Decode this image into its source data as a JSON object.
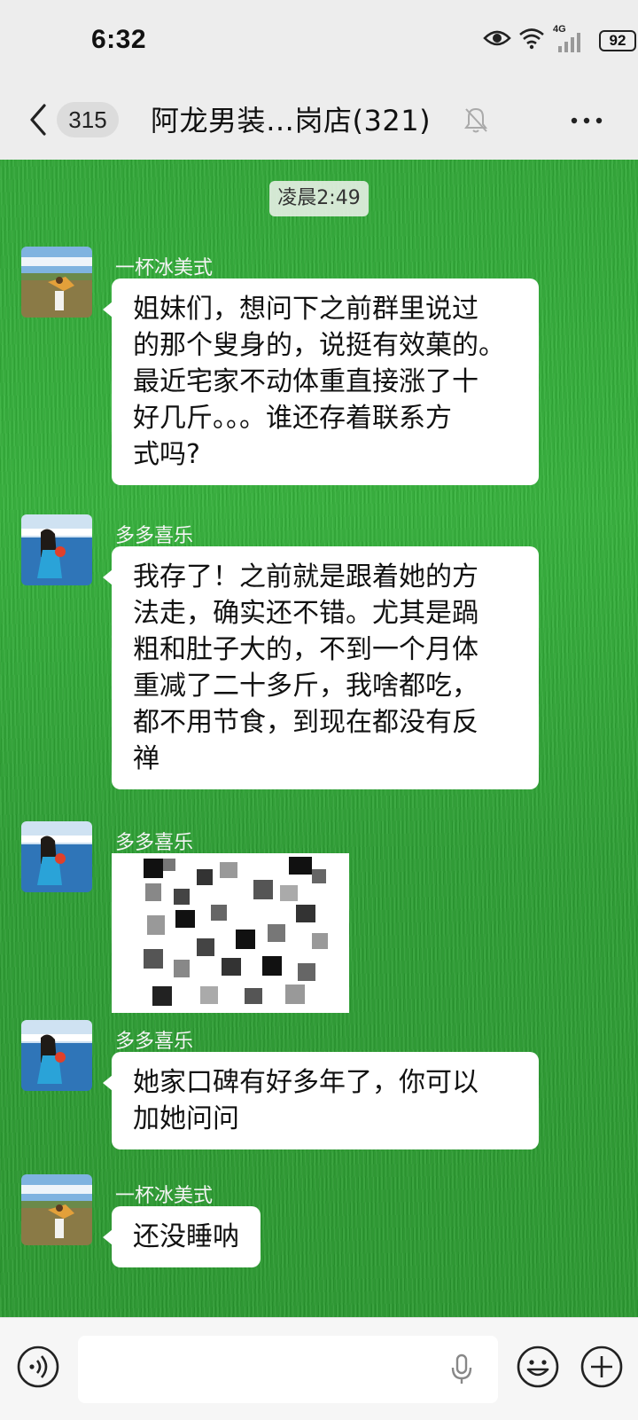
{
  "status_bar": {
    "time": "6:32",
    "network": "4G",
    "battery": "92",
    "icons": [
      "eye-icon",
      "wifi-icon",
      "signal-icon",
      "battery-icon"
    ]
  },
  "nav": {
    "unread_count": "315",
    "title": "阿龙男装…岗店(321)",
    "icons": [
      "back-icon",
      "mute-icon",
      "more-icon"
    ]
  },
  "chat": {
    "timestamp": "凌晨2:49",
    "messages": [
      {
        "sender": "一杯冰美式",
        "type": "text",
        "lines": [
          "姐妹们，想问下之前群里说过",
          "的那个叟身的，说挺有效菓的。",
          "最近宅家不动体重直接涨了十",
          "好几斤。。。谁还存着联系方",
          "式吗?"
        ]
      },
      {
        "sender": "多多喜乐",
        "type": "text",
        "lines": [
          "我存了！之前就是跟着她的方",
          "法走，确实还不错。尤其是踻",
          "粗和肚子大的，不到一个月体",
          "重减了二十多斤，我啥都吃，",
          "都不用节食，到现在都没有反",
          "禅"
        ]
      },
      {
        "sender": "多多喜乐",
        "type": "image",
        "image": "pixelated-qr-image"
      },
      {
        "sender": "多多喜乐",
        "type": "text",
        "lines": [
          "她家口碑有好多年了，你可以",
          "加她问问"
        ]
      },
      {
        "sender": "一杯冰美式",
        "type": "text",
        "lines": [
          "还没睡呐"
        ]
      }
    ]
  },
  "input_bar": {
    "icons": [
      "voice-icon",
      "mic-icon",
      "emoji-icon",
      "plus-icon"
    ]
  },
  "colors": {
    "grass_green": "#2fa836",
    "bubble": "#ffffff",
    "bar_bg": "#ededed"
  }
}
